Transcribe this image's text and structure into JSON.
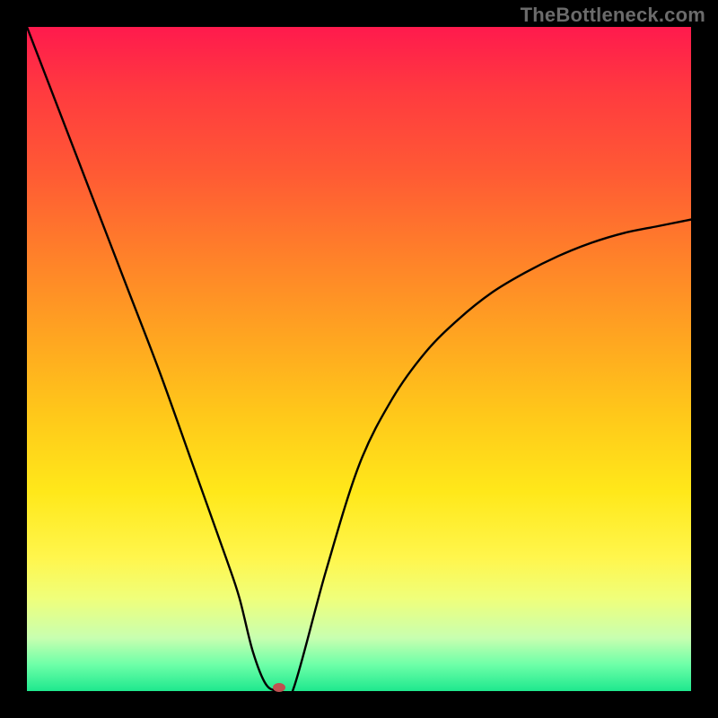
{
  "watermark": "TheBottleneck.com",
  "chart_data": {
    "type": "line",
    "title": "",
    "xlabel": "",
    "ylabel": "",
    "xlim": [
      0,
      100
    ],
    "ylim": [
      0,
      100
    ],
    "grid": false,
    "series": [
      {
        "name": "curve",
        "x": [
          0,
          5,
          10,
          15,
          20,
          25,
          30,
          32,
          34,
          36,
          38,
          40,
          45,
          50,
          55,
          60,
          65,
          70,
          75,
          80,
          85,
          90,
          95,
          100
        ],
        "y": [
          100,
          87,
          74,
          61,
          48,
          34,
          20,
          14,
          6,
          1,
          0,
          0,
          18,
          34,
          44,
          51,
          56,
          60,
          63,
          65.5,
          67.5,
          69,
          70,
          71
        ]
      }
    ],
    "marker": {
      "x": 38,
      "y": 0.5,
      "color": "#c05050"
    },
    "gradient_stops": [
      {
        "pos": 0,
        "color": "#ff1a4d"
      },
      {
        "pos": 10,
        "color": "#ff3b3f"
      },
      {
        "pos": 22,
        "color": "#ff5a34"
      },
      {
        "pos": 34,
        "color": "#ff7f2a"
      },
      {
        "pos": 46,
        "color": "#ffa321"
      },
      {
        "pos": 58,
        "color": "#ffc71a"
      },
      {
        "pos": 70,
        "color": "#ffe81a"
      },
      {
        "pos": 80,
        "color": "#fff64d"
      },
      {
        "pos": 86,
        "color": "#f0ff7a"
      },
      {
        "pos": 92,
        "color": "#c8ffb0"
      },
      {
        "pos": 96,
        "color": "#6effa8"
      },
      {
        "pos": 100,
        "color": "#1ee88e"
      }
    ]
  }
}
